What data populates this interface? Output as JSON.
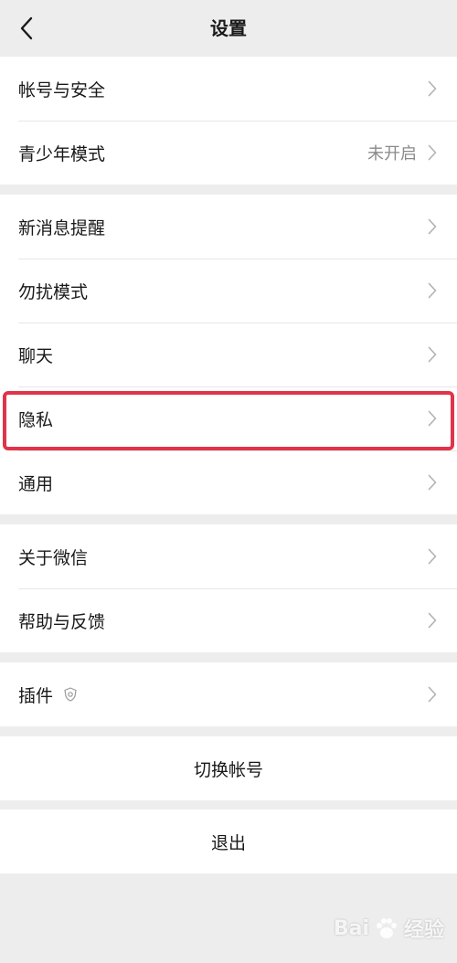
{
  "nav": {
    "title": "设置",
    "back_icon": "chevron-left-icon"
  },
  "groups": [
    {
      "rows": [
        {
          "label": "帐号与安全"
        },
        {
          "label": "青少年模式",
          "value": "未开启"
        }
      ]
    },
    {
      "rows": [
        {
          "label": "新消息提醒"
        },
        {
          "label": "勿扰模式"
        },
        {
          "label": "聊天"
        },
        {
          "label": "隐私"
        },
        {
          "label": "通用"
        }
      ]
    },
    {
      "rows": [
        {
          "label": "关于微信"
        },
        {
          "label": "帮助与反馈"
        }
      ]
    },
    {
      "rows": [
        {
          "label": "插件",
          "icon": "plugin-shield-icon"
        }
      ]
    }
  ],
  "actions": {
    "switch_account": "切换帐号",
    "logout": "退出"
  },
  "highlight": {
    "target": "隐私",
    "color": "#e0344a"
  },
  "watermark": {
    "text_left": "Bai",
    "text_right": "经验",
    "icon": "paw-icon"
  },
  "colors": {
    "background": "#ededed",
    "card": "#ffffff",
    "divider": "#e7e7e7",
    "secondary_text": "#8a8a8a",
    "chevron": "#b2b2b2"
  }
}
